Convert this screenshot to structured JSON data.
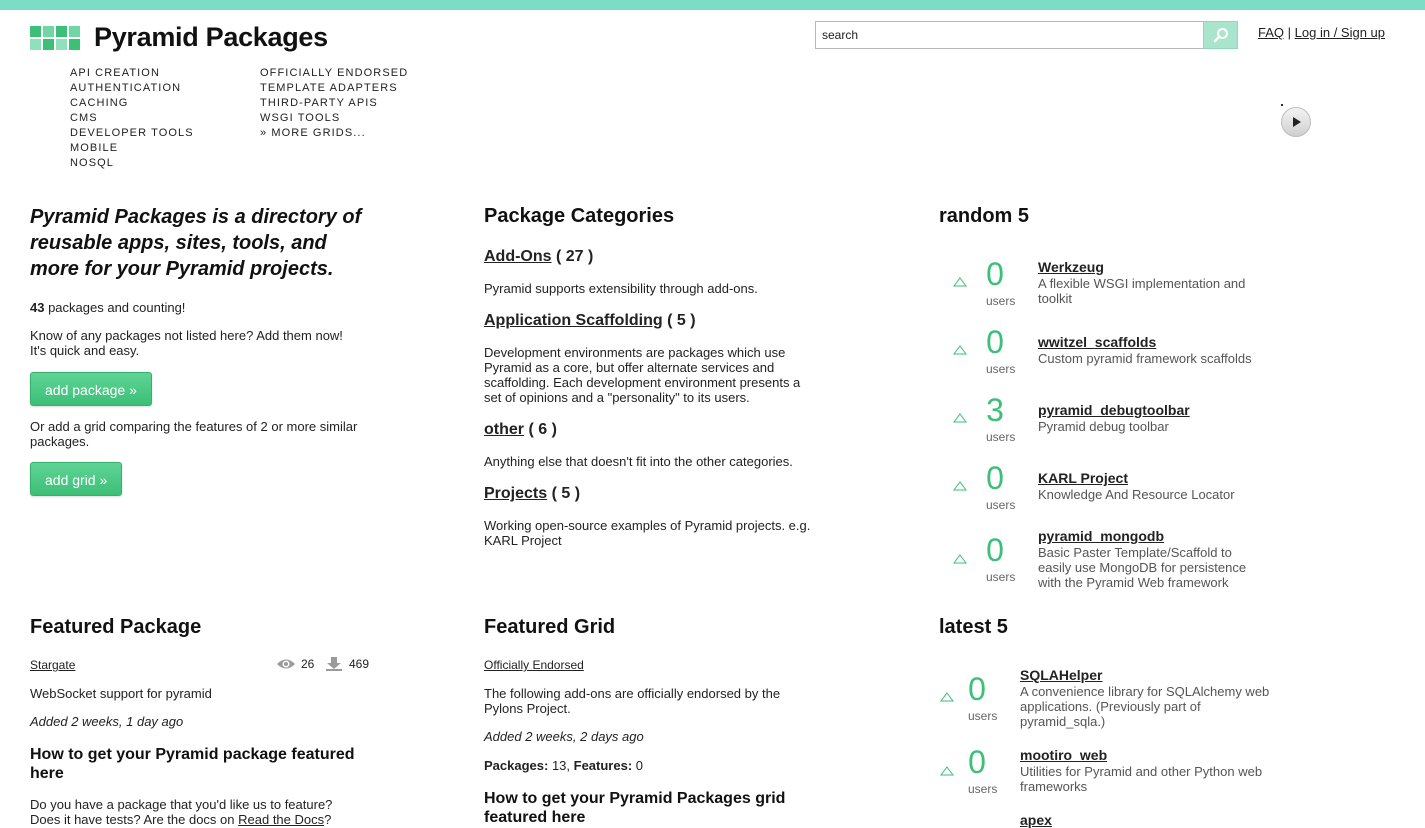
{
  "site": {
    "title": "Pyramid Packages",
    "logo_colors": [
      "#3cbf77",
      "#6fd6a4",
      "#3cbf77",
      "#6fd6a4",
      "#8fe0bb",
      "#3cbf77",
      "#8fe0bb",
      "#3cbf77"
    ]
  },
  "search": {
    "placeholder": "search",
    "value": "search"
  },
  "toplinks": {
    "faq": "FAQ",
    "separator": "|",
    "login": "Log in / Sign up"
  },
  "nav": {
    "col1": [
      "API CREATION",
      "AUTHENTICATION",
      "CACHING",
      "CMS",
      "DEVELOPER TOOLS",
      "MOBILE",
      "NOSQL"
    ],
    "col2": [
      "OFFICIALLY ENDORSED",
      "TEMPLATE ADAPTERS",
      "THIRD-PARTY APIS",
      "WSGI TOOLS",
      "» MORE GRIDS..."
    ]
  },
  "intro": {
    "tagline": "Pyramid Packages is a directory of reusable apps, sites, tools, and more for your Pyramid projects.",
    "count": "43",
    "count_suffix": " packages and counting!",
    "know_text": "Know of any packages not listed here? Add them now! It's quick and easy.",
    "add_package": "add package »",
    "grid_text": "Or add a grid comparing the features of 2 or more similar packages.",
    "add_grid": "add grid »"
  },
  "categories": {
    "heading": "Package Categories",
    "items": [
      {
        "name": "Add-Ons",
        "count": " ( 27 )",
        "desc": "Pyramid supports extensibility through add-ons."
      },
      {
        "name": "Application Scaffolding",
        "count": " ( 5 )",
        "desc": "Development environments are packages which use Pyramid as a core, but offer alternate services and scaffolding. Each development environment presents a set of opinions and a \"personality\" to its users."
      },
      {
        "name": "other",
        "count": " ( 6 )",
        "desc": "Anything else that doesn't fit into the other categories."
      },
      {
        "name": "Projects",
        "count": " ( 5 )",
        "desc": "Working open-source examples of Pyramid projects. e.g. KARL Project"
      }
    ]
  },
  "random": {
    "heading": "random 5",
    "items": [
      {
        "count": "0",
        "users": "users",
        "name": "Werkzeug",
        "desc": "A flexible WSGI implementation and toolkit"
      },
      {
        "count": "0",
        "users": "users",
        "name": "wwitzel_scaffolds",
        "desc": "Custom pyramid framework scaffolds"
      },
      {
        "count": "3",
        "users": "users",
        "name": "pyramid_debugtoolbar",
        "desc": "Pyramid debug toolbar"
      },
      {
        "count": "0",
        "users": "users",
        "name": "KARL Project",
        "desc": "Knowledge And Resource Locator"
      },
      {
        "count": "0",
        "users": "users",
        "name": "pyramid_mongodb",
        "desc": "Basic Paster Template/Scaffold to easily use MongoDB for persistence with the Pyramid Web framework"
      }
    ]
  },
  "featured_package": {
    "heading": "Featured Package",
    "name": "Stargate",
    "views": "26",
    "downloads": "469",
    "desc": "WebSocket support for pyramid",
    "added": "Added 2 weeks, 1 day ago",
    "how_heading": "How to get your Pyramid package featured here",
    "how_text": "Do you have a package that you'd like us to feature? Does it have tests? Are the docs on ",
    "docs_link": "Read the Docs",
    "how_end": "?"
  },
  "featured_grid": {
    "heading": "Featured Grid",
    "name": "Officially Endorsed",
    "desc": "The following add-ons are officially endorsed by the Pylons Project.",
    "added": "Added 2 weeks, 2 days ago",
    "packages_label": "Packages:",
    "packages": " 13, ",
    "features_label": "Features:",
    "features": " 0",
    "how_heading": "How to get your Pyramid Packages grid featured here"
  },
  "latest": {
    "heading": "latest 5",
    "items": [
      {
        "count": "0",
        "users": "users",
        "name": "SQLAHelper",
        "desc": "A convenience library for SQLAlchemy web applications. (Previously part of pyramid_sqla.)"
      },
      {
        "count": "0",
        "users": "users",
        "name": "mootiro_web",
        "desc": "Utilities for Pyramid and other Python web frameworks"
      },
      {
        "name": "apex"
      }
    ]
  }
}
